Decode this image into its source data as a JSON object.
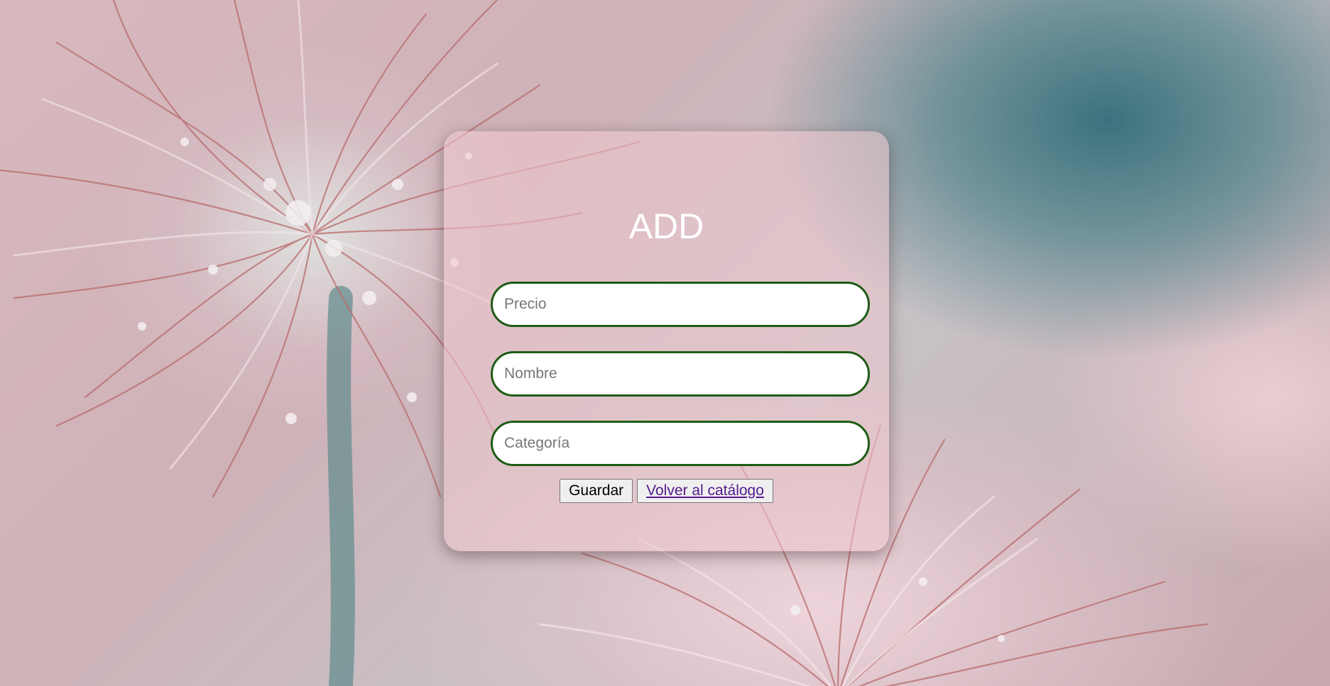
{
  "form": {
    "title": "ADD",
    "fields": [
      {
        "placeholder": "Precio",
        "value": ""
      },
      {
        "placeholder": "Nombre",
        "value": ""
      },
      {
        "placeholder": "Categoría",
        "value": ""
      }
    ],
    "save_label": "Guardar",
    "back_label": "Volver al catálogo"
  },
  "colors": {
    "field_border": "#1d5c14",
    "title_text": "#ffffff",
    "link": "#551a8b"
  }
}
